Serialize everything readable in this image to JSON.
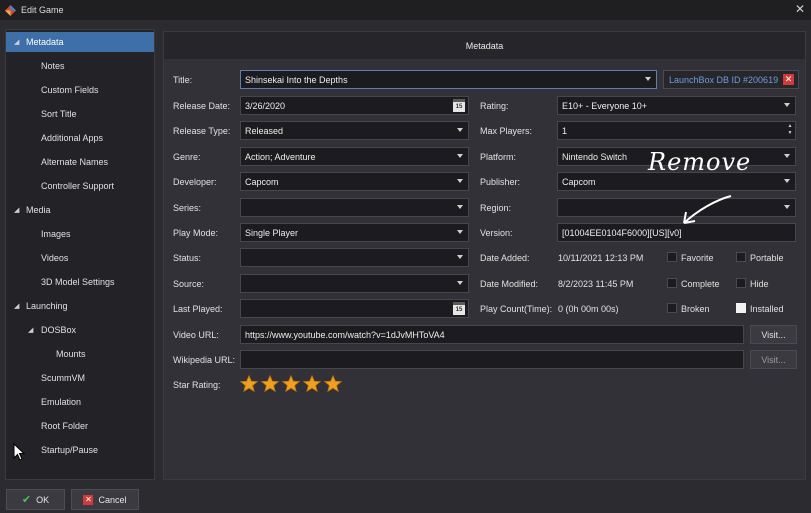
{
  "window": {
    "title": "Edit Game"
  },
  "sidebar": {
    "items": [
      {
        "label": "Metadata",
        "selected": true
      },
      {
        "label": "Notes"
      },
      {
        "label": "Custom Fields"
      },
      {
        "label": "Sort Title"
      },
      {
        "label": "Additional Apps"
      },
      {
        "label": "Alternate Names"
      },
      {
        "label": "Controller Support"
      },
      {
        "label": "Media"
      },
      {
        "label": "Images"
      },
      {
        "label": "Videos"
      },
      {
        "label": "3D Model Settings"
      },
      {
        "label": "Launching"
      },
      {
        "label": "DOSBox"
      },
      {
        "label": "Mounts"
      },
      {
        "label": "ScummVM"
      },
      {
        "label": "Emulation"
      },
      {
        "label": "Root Folder"
      },
      {
        "label": "Startup/Pause"
      }
    ]
  },
  "header": {
    "title": "Metadata"
  },
  "form": {
    "title": {
      "label": "Title:",
      "value": "Shinsekai Into the Depths"
    },
    "launchbox_id": "LaunchBox DB ID #200619",
    "release_date": {
      "label": "Release Date:",
      "value": "3/26/2020"
    },
    "rating": {
      "label": "Rating:",
      "value": "E10+ - Everyone 10+"
    },
    "release_type": {
      "label": "Release Type:",
      "value": "Released"
    },
    "max_players": {
      "label": "Max Players:",
      "value": "1"
    },
    "genre": {
      "label": "Genre:",
      "value": "Action; Adventure"
    },
    "platform": {
      "label": "Platform:",
      "value": "Nintendo Switch"
    },
    "developer": {
      "label": "Developer:",
      "value": "Capcom"
    },
    "publisher": {
      "label": "Publisher:",
      "value": "Capcom"
    },
    "series": {
      "label": "Series:",
      "value": ""
    },
    "region": {
      "label": "Region:",
      "value": ""
    },
    "play_mode": {
      "label": "Play Mode:",
      "value": "Single Player"
    },
    "version": {
      "label": "Version:",
      "value": "[01004EE0104F6000][US][v0]"
    },
    "status": {
      "label": "Status:",
      "value": ""
    },
    "date_added": {
      "label": "Date Added:",
      "value": "10/11/2021 12:13 PM"
    },
    "source": {
      "label": "Source:",
      "value": ""
    },
    "date_modified": {
      "label": "Date Modified:",
      "value": "8/2/2023 11:45 PM"
    },
    "last_played": {
      "label": "Last Played:",
      "value": ""
    },
    "play_count": {
      "label": "Play Count(Time):",
      "value": "0 (0h 00m 00s)"
    },
    "video_url": {
      "label": "Video URL:",
      "value": "https://www.youtube.com/watch?v=1dJvMHToVA4"
    },
    "wikipedia_url": {
      "label": "Wikipedia URL:",
      "value": ""
    },
    "star_rating": {
      "label": "Star Rating:",
      "value": 5,
      "max": 5
    },
    "visit_label": "Visit...",
    "checkboxes": {
      "favorite": {
        "label": "Favorite",
        "checked": false
      },
      "portable": {
        "label": "Portable",
        "checked": false
      },
      "complete": {
        "label": "Complete",
        "checked": false
      },
      "hide": {
        "label": "Hide",
        "checked": false
      },
      "broken": {
        "label": "Broken",
        "checked": false
      },
      "installed": {
        "label": "Installed",
        "checked": true
      }
    }
  },
  "annotation": {
    "text": "Remove"
  },
  "footer": {
    "ok": "OK",
    "cancel": "Cancel"
  },
  "colors": {
    "accent": "#3e6fa8",
    "link": "#6f9de0",
    "star": "#f0a020",
    "close": "#d23a3a"
  }
}
